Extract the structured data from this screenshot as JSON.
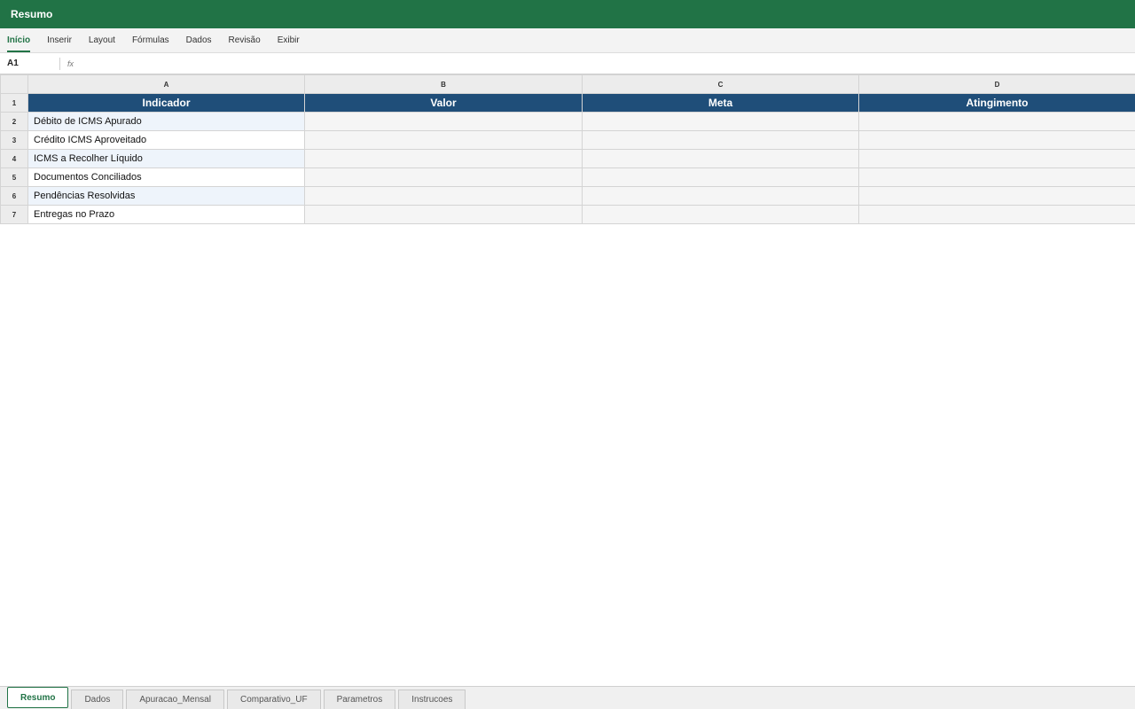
{
  "window": {
    "title": "Resumo"
  },
  "ribbon": {
    "tabs": [
      {
        "label": "Início",
        "active": true
      },
      {
        "label": "Inserir"
      },
      {
        "label": "Layout"
      },
      {
        "label": "Fórmulas"
      },
      {
        "label": "Dados"
      },
      {
        "label": "Revisão"
      },
      {
        "label": "Exibir"
      }
    ]
  },
  "formula_bar": {
    "cell_ref": "A1",
    "fx_label": "fx",
    "value": ""
  },
  "grid": {
    "columns": [
      "A",
      "B",
      "C",
      "D"
    ],
    "header_row_number": "1",
    "headers": [
      "Indicador",
      "Valor",
      "Meta",
      "Atingimento"
    ],
    "rows": [
      {
        "num": "2",
        "label": "Débito de ICMS Apurado"
      },
      {
        "num": "3",
        "label": "Crédito ICMS Aproveitado"
      },
      {
        "num": "4",
        "label": "ICMS a Recolher Líquido"
      },
      {
        "num": "5",
        "label": "Documentos Conciliados"
      },
      {
        "num": "6",
        "label": "Pendências Resolvidas"
      },
      {
        "num": "7",
        "label": "Entregas no Prazo"
      }
    ]
  },
  "sheets": [
    {
      "label": "Resumo",
      "active": true
    },
    {
      "label": "Dados"
    },
    {
      "label": "Apuracao_Mensal"
    },
    {
      "label": "Comparativo_UF"
    },
    {
      "label": "Parametros"
    },
    {
      "label": "Instrucoes"
    }
  ],
  "colors": {
    "brand": "#217346",
    "header_fill": "#1f4e79",
    "band_fill": "#eef4fb",
    "value_fill": "#f5f5f5"
  }
}
